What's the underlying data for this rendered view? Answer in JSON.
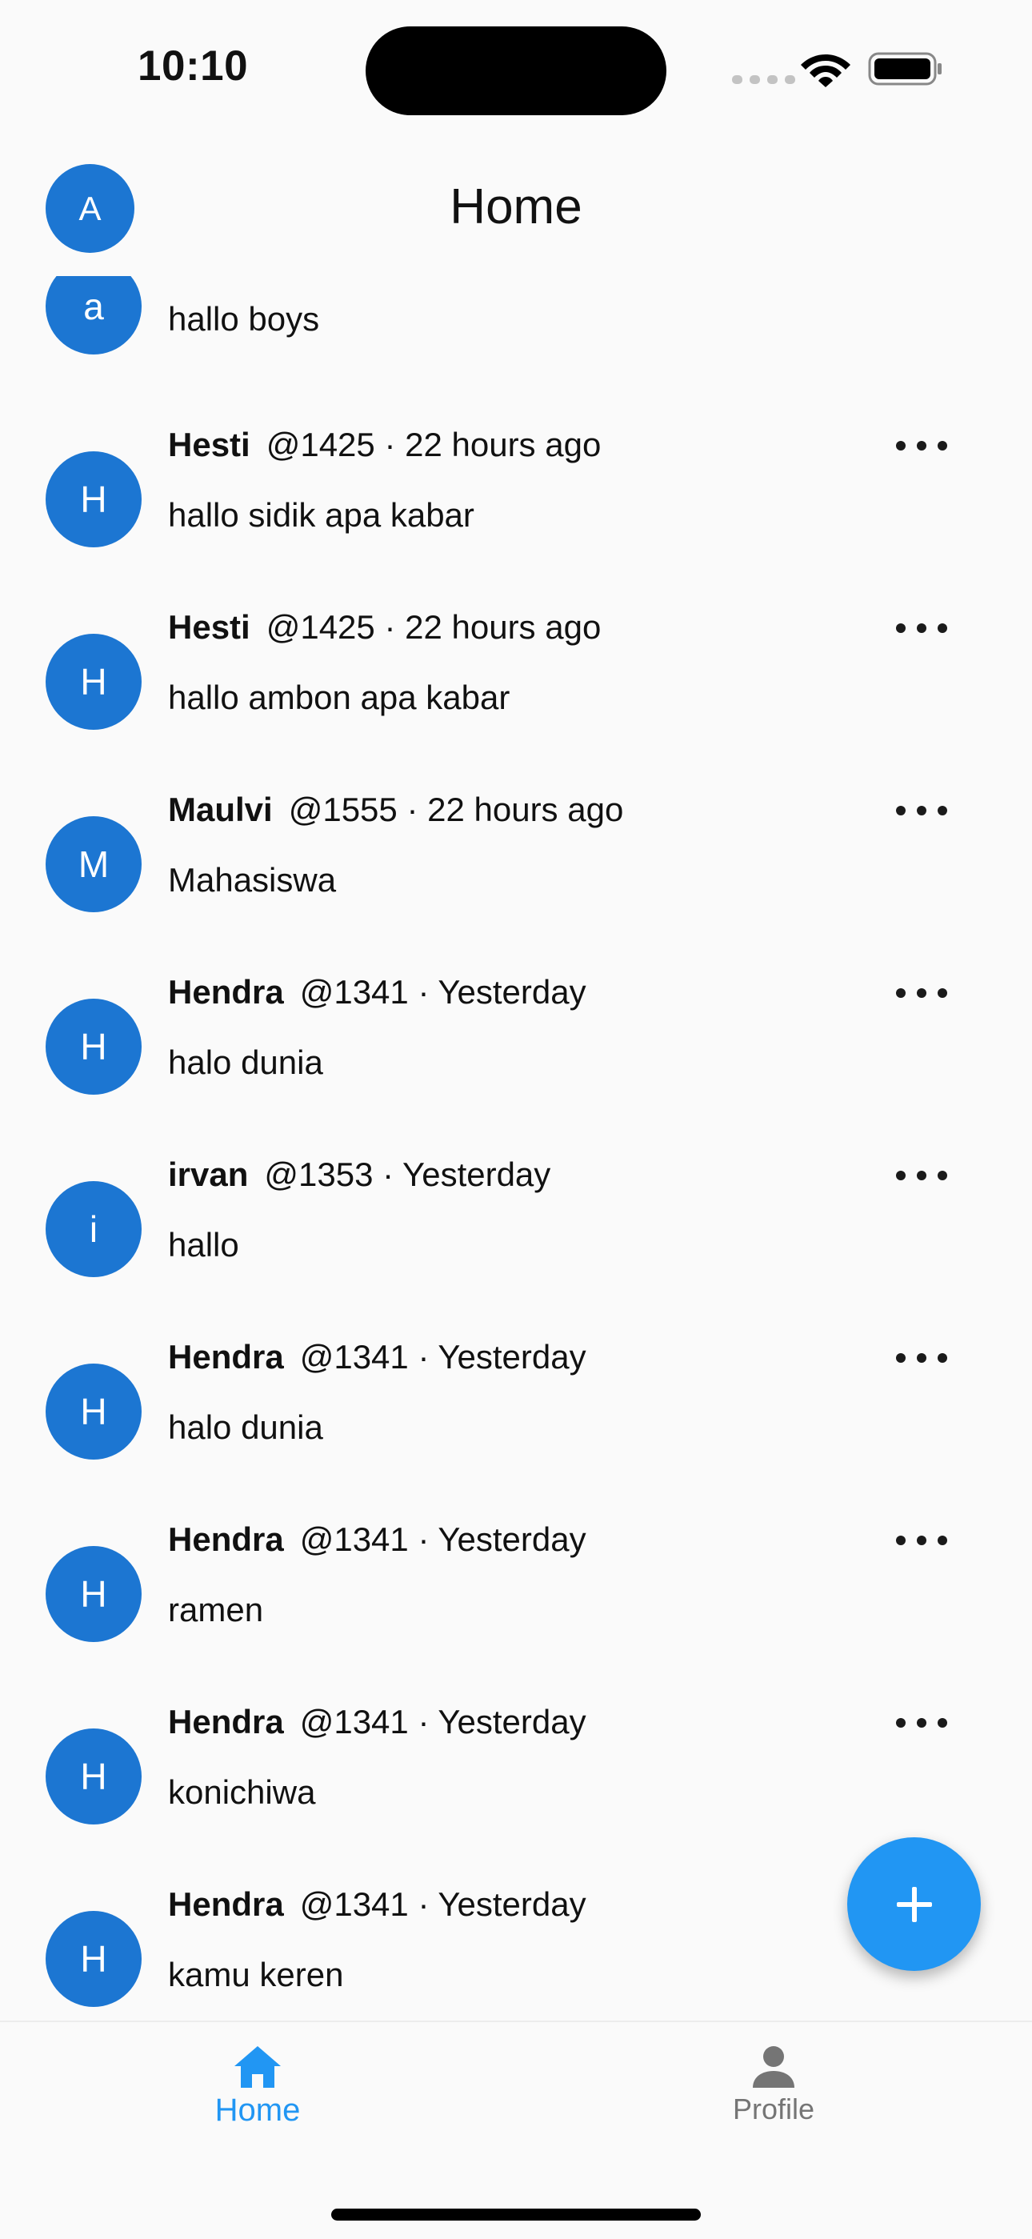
{
  "status_bar": {
    "time": "10:10"
  },
  "app_bar": {
    "title": "Home",
    "avatar_letter": "A"
  },
  "posts": [
    {
      "initial": "a",
      "author": "",
      "handle": "",
      "time": "",
      "content": "hallo boys"
    },
    {
      "initial": "H",
      "author": "Hesti",
      "handle": "@1425",
      "time": "22 hours ago",
      "content": "hallo sidik apa kabar"
    },
    {
      "initial": "H",
      "author": "Hesti",
      "handle": "@1425",
      "time": "22 hours ago",
      "content": "hallo ambon apa kabar"
    },
    {
      "initial": "M",
      "author": "Maulvi",
      "handle": "@1555",
      "time": "22 hours ago",
      "content": "Mahasiswa"
    },
    {
      "initial": "H",
      "author": "Hendra",
      "handle": "@1341",
      "time": "Yesterday",
      "content": "halo dunia"
    },
    {
      "initial": "i",
      "author": "irvan",
      "handle": "@1353",
      "time": "Yesterday",
      "content": "hallo"
    },
    {
      "initial": "H",
      "author": "Hendra",
      "handle": "@1341",
      "time": "Yesterday",
      "content": "halo dunia"
    },
    {
      "initial": "H",
      "author": "Hendra",
      "handle": "@1341",
      "time": "Yesterday",
      "content": "ramen"
    },
    {
      "initial": "H",
      "author": "Hendra",
      "handle": "@1341",
      "time": "Yesterday",
      "content": "konichiwa"
    },
    {
      "initial": "H",
      "author": "Hendra",
      "handle": "@1341",
      "time": "Yesterday",
      "content": "kamu keren"
    }
  ],
  "fab": {
    "icon": "plus-icon"
  },
  "bottom_nav": {
    "items": [
      {
        "label": "Home",
        "icon": "home-icon",
        "active": true
      },
      {
        "label": "Profile",
        "icon": "person-icon",
        "active": false
      }
    ]
  },
  "colors": {
    "avatar": "#1c76d2",
    "accent": "#2196f3",
    "inactive": "#757575",
    "background": "#fafafa"
  }
}
